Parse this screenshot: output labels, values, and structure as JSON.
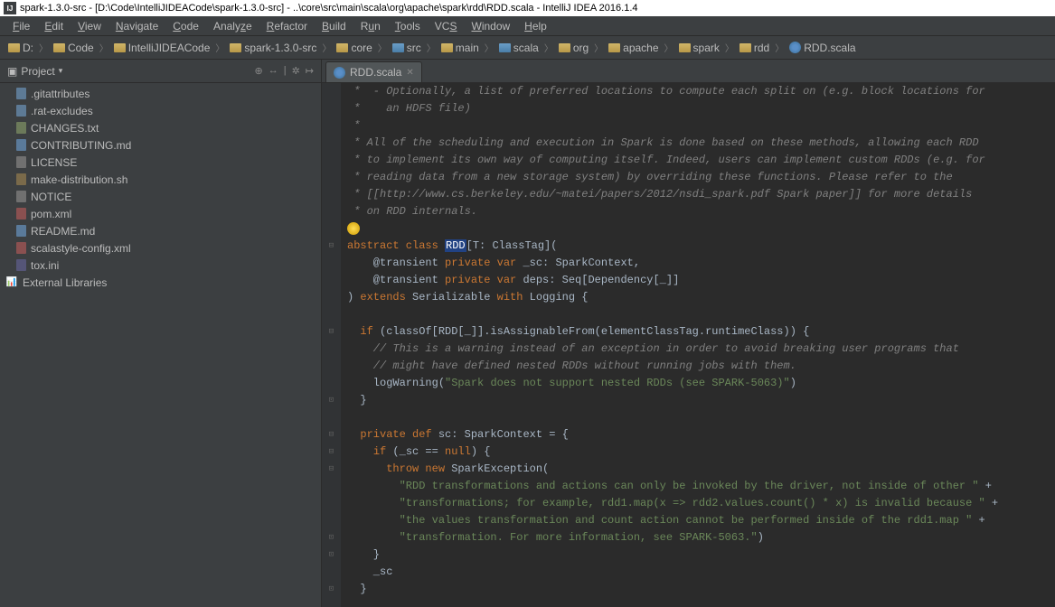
{
  "titlebar": "spark-1.3.0-src - [D:\\Code\\IntelliJIDEACode\\spark-1.3.0-src] - ..\\core\\src\\main\\scala\\org\\apache\\spark\\rdd\\RDD.scala - IntelliJ IDEA 2016.1.4",
  "menu": [
    "File",
    "Edit",
    "View",
    "Navigate",
    "Code",
    "Analyze",
    "Refactor",
    "Build",
    "Run",
    "Tools",
    "VCS",
    "Window",
    "Help"
  ],
  "breadcrumb": [
    "D:",
    "Code",
    "IntelliJIDEACode",
    "spark-1.3.0-src",
    "core",
    "src",
    "main",
    "scala",
    "org",
    "apache",
    "spark",
    "rdd",
    "RDD.scala"
  ],
  "sidebar": {
    "title": "Project",
    "items": [
      {
        "icon": "file",
        "label": ".gitattributes"
      },
      {
        "icon": "file",
        "label": ".rat-excludes"
      },
      {
        "icon": "file-txt",
        "label": "CHANGES.txt"
      },
      {
        "icon": "file-md",
        "label": "CONTRIBUTING.md"
      },
      {
        "icon": "file-lic",
        "label": "LICENSE"
      },
      {
        "icon": "file-sh",
        "label": "make-distribution.sh"
      },
      {
        "icon": "file-lic",
        "label": "NOTICE"
      },
      {
        "icon": "file-xml",
        "label": "pom.xml"
      },
      {
        "icon": "file-md",
        "label": "README.md"
      },
      {
        "icon": "file-xml",
        "label": "scalastyle-config.xml"
      },
      {
        "icon": "file-ini",
        "label": "tox.ini"
      },
      {
        "icon": "lib",
        "label": "External Libraries"
      }
    ]
  },
  "tab": {
    "label": "RDD.scala"
  },
  "code": {
    "l1": " *  - Optionally, a list of preferred locations to compute each split on (e.g. block locations for",
    "l2": " *    an HDFS file)",
    "l3": " *",
    "l4": " * All of the scheduling and execution in Spark is done based on these methods, allowing each RDD",
    "l5": " * to implement its own way of computing itself. Indeed, users can implement custom RDDs (e.g. for",
    "l6": " * reading data from a new storage system) by overriding these functions. Please refer to the",
    "l7": " * [[http://www.cs.berkeley.edu/~matei/papers/2012/nsdi_spark.pdf Spark paper]] for more details",
    "l8": " * on RDD internals.",
    "l9": "abstract class ",
    "l9h": "RDD",
    "l9b": "[T: ClassTag](",
    "l10a": "    @transient ",
    "l10b": "private var",
    "l10c": " _sc: SparkContext,",
    "l11a": "    @transient ",
    "l11b": "private var",
    "l11c": " deps: Seq[Dependency[_]]",
    "l12a": ") ",
    "l12b": "extends",
    "l12c": " Serializable ",
    "l12d": "with",
    "l12e": " Logging {",
    "l14a": "  ",
    "l14b": "if",
    "l14c": " (classOf[RDD[_]].isAssignableFrom(elementClassTag.runtimeClass)) {",
    "l15": "    // This is a warning instead of an exception in order to avoid breaking user programs that",
    "l16": "    // might have defined nested RDDs without running jobs with them.",
    "l17a": "    logWarning(",
    "l17b": "\"Spark does not support nested RDDs (see SPARK-5063)\"",
    "l17c": ")",
    "l18": "  }",
    "l20a": "  ",
    "l20b": "private def",
    "l20c": " sc: SparkContext = {",
    "l21a": "    ",
    "l21b": "if",
    "l21c": " (_sc == ",
    "l21d": "null",
    "l21e": ") {",
    "l22a": "      ",
    "l22b": "throw new",
    "l22c": " SparkException(",
    "l23": "        \"RDD transformations and actions can only be invoked by the driver, not inside of other \"",
    "l23b": " +",
    "l24": "        \"transformations; for example, rdd1.map(x => rdd2.values.count() * x) is invalid because \"",
    "l24b": " +",
    "l25": "        \"the values transformation and count action cannot be performed inside of the rdd1.map \"",
    "l25b": " +",
    "l26": "        \"transformation. For more information, see SPARK-5063.\"",
    "l26b": ")",
    "l27": "    }",
    "l28": "    _sc",
    "l29": "  }"
  }
}
